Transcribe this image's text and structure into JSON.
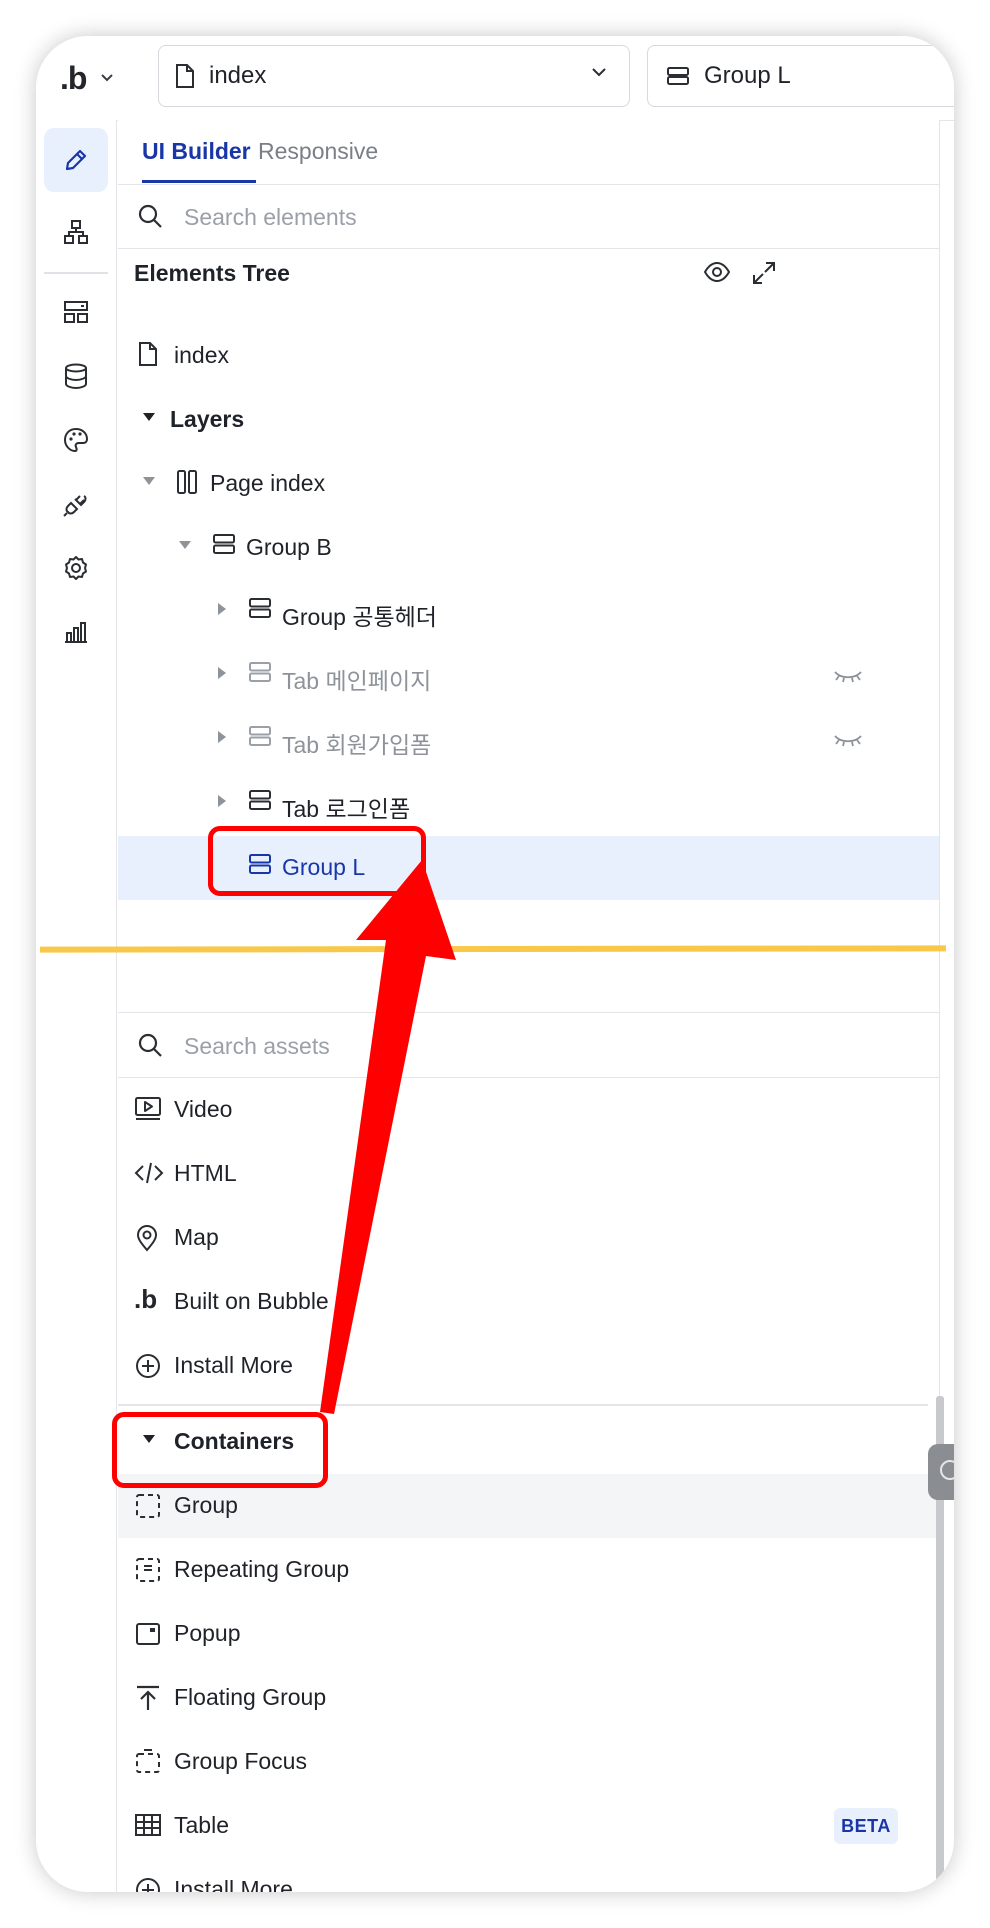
{
  "topbar": {
    "logo": ".b",
    "page_select": "index",
    "element_select": "Group L"
  },
  "tabs": {
    "ui_builder": "UI Builder",
    "responsive": "Responsive"
  },
  "elements_search": {
    "placeholder": "Search elements"
  },
  "elements_tree": {
    "title": "Elements Tree",
    "page_label": "index",
    "layers_label": "Layers",
    "page_item": "Page index",
    "group_b": "Group B",
    "children": [
      {
        "label": "Group 공통헤더",
        "hidden": false
      },
      {
        "label": "Tab 메인페이지",
        "hidden": true
      },
      {
        "label": "Tab 회원가입폼",
        "hidden": true
      },
      {
        "label": "Tab 로그인폼",
        "hidden": false
      }
    ],
    "selected_item": "Group L"
  },
  "assets_search": {
    "placeholder": "Search assets"
  },
  "assets": {
    "visual": [
      "Video",
      "HTML",
      "Map",
      "Built on Bubble",
      "Install More"
    ],
    "containers_label": "Containers",
    "containers": [
      "Group",
      "Repeating Group",
      "Popup",
      "Floating Group",
      "Group Focus",
      "Table",
      "Install More"
    ],
    "beta_badge": "BETA"
  },
  "colors": {
    "accent": "#1936a8",
    "selection": "#e8f0fe",
    "annotation": "#ff0000",
    "divider_annotation": "#f8c84a"
  }
}
